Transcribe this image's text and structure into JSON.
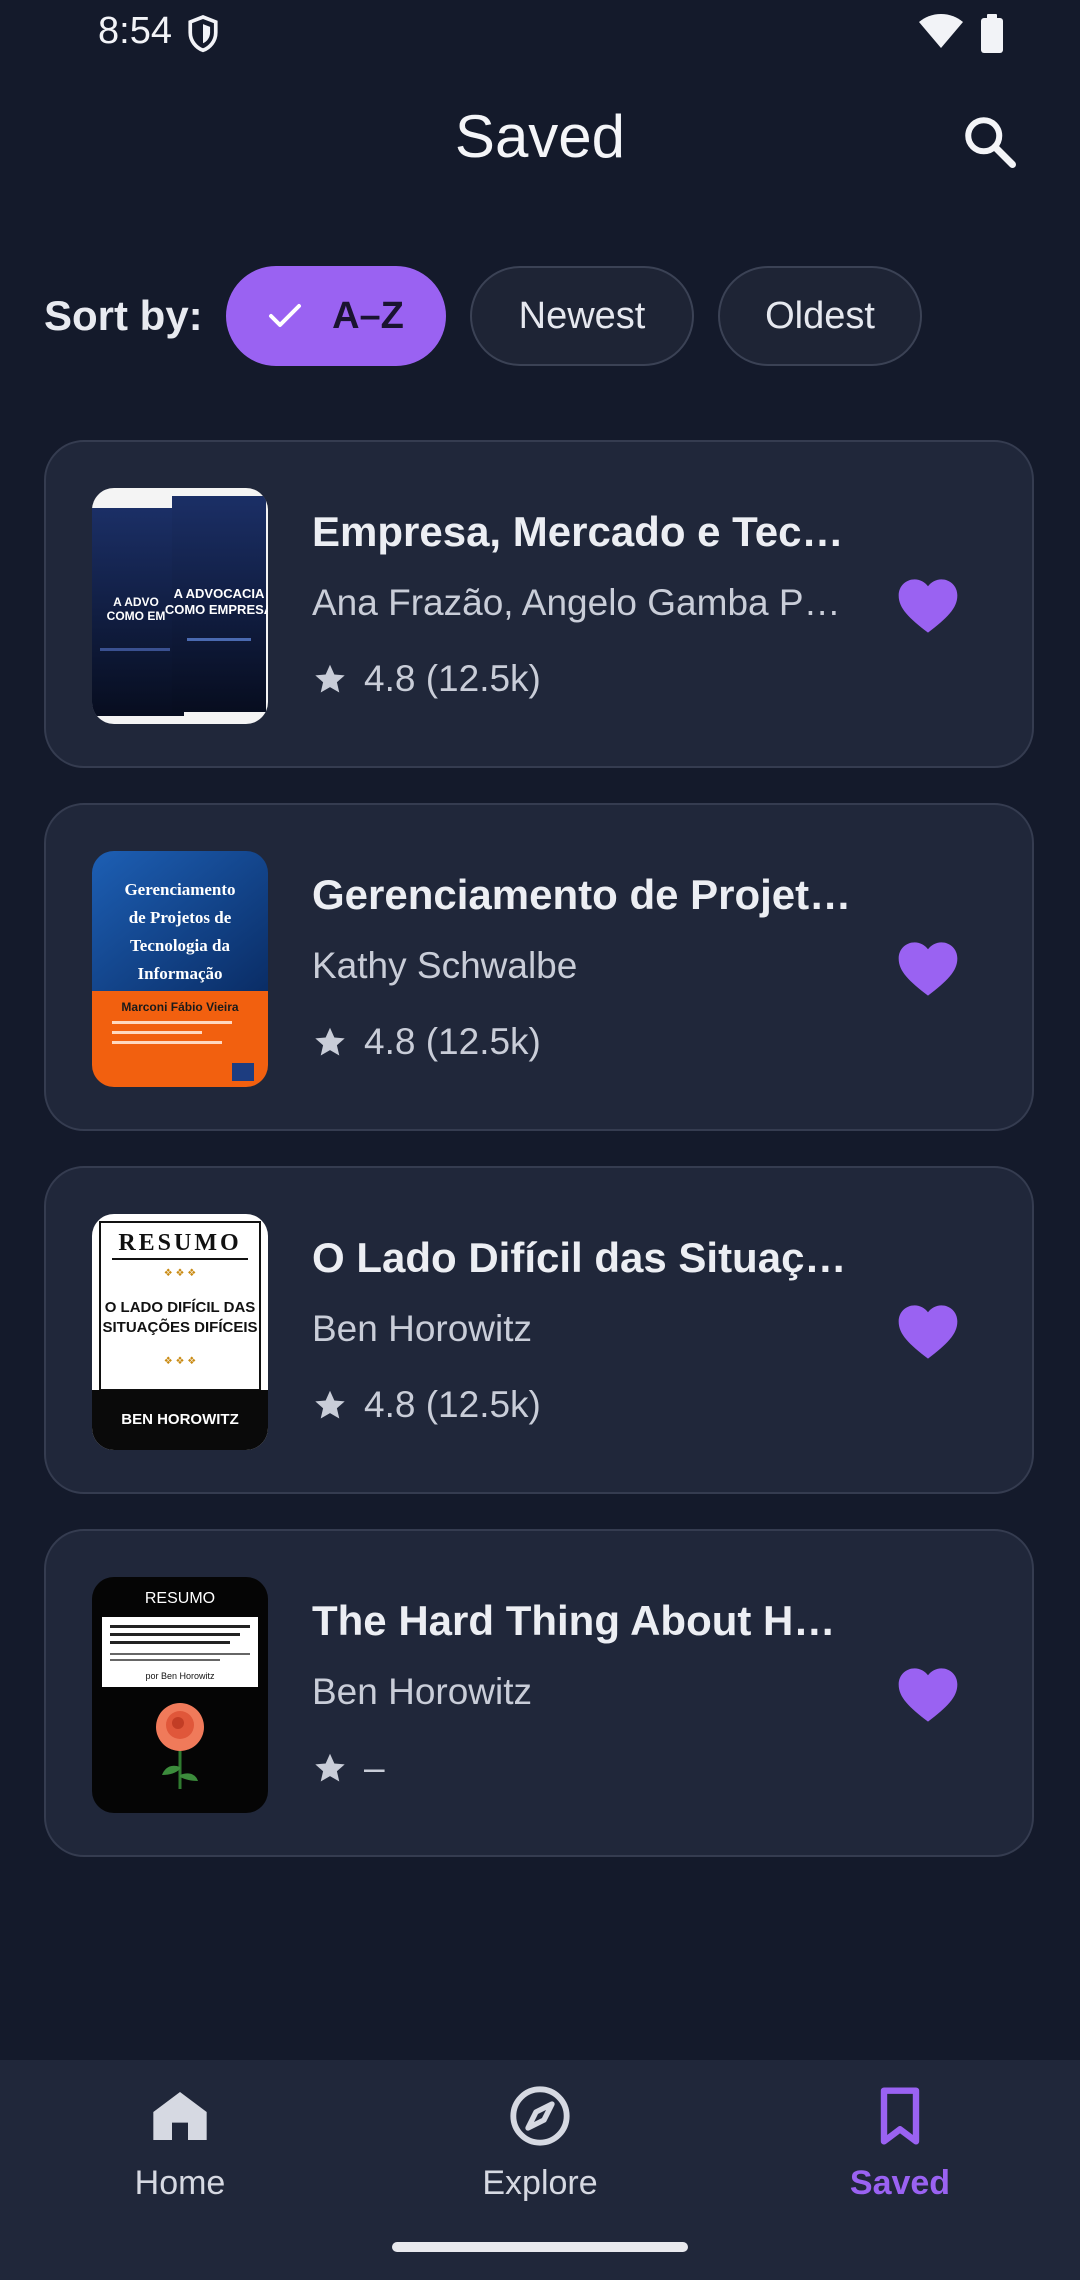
{
  "status_bar": {
    "time": "8:54"
  },
  "header": {
    "title": "Saved",
    "search_icon": "search-icon"
  },
  "sort": {
    "label": "Sort by:",
    "options": [
      "A–Z",
      "Newest",
      "Oldest"
    ],
    "selected": "A–Z"
  },
  "books": [
    {
      "title": "Empresa, Mercado e Tec…",
      "author": "Ana Frazão, Angelo Gamba P…",
      "rating": "4.8 (12.5k)",
      "saved": true
    },
    {
      "title": "Gerenciamento de Projet…",
      "author": "Kathy Schwalbe",
      "rating": "4.8 (12.5k)",
      "saved": true
    },
    {
      "title": "O Lado Difícil das Situaç…",
      "author": "Ben Horowitz",
      "rating": "4.8 (12.5k)",
      "saved": true
    },
    {
      "title": "The Hard Thing About H…",
      "author": "Ben Horowitz",
      "rating": "–",
      "saved": true
    }
  ],
  "covers": {
    "cover1_text_a": "A ADVOCACIA COMO EMPRESA",
    "cover2_lines": [
      "Gerenciamento",
      "de Projetos de",
      "Tecnologia da",
      "Informação"
    ],
    "cover2_author": "Marconi Fábio Vieira",
    "cover3_header": "RESUMO",
    "cover3_title_lines": [
      "O LADO DIFÍCIL DAS",
      "SITUAÇÕES DIFÍCEIS"
    ],
    "cover3_author": "BEN HOROWITZ",
    "cover4_header": "RESUMO",
    "cover4_author": "por Ben Horowitz"
  },
  "bottom_nav": {
    "items": [
      {
        "label": "Home",
        "icon": "home-icon"
      },
      {
        "label": "Explore",
        "icon": "compass-icon"
      },
      {
        "label": "Saved",
        "icon": "bookmark-icon"
      }
    ],
    "active": "Saved"
  },
  "colors": {
    "background": "#141a2b",
    "card": "#20273a",
    "accent": "#9a62f2"
  }
}
